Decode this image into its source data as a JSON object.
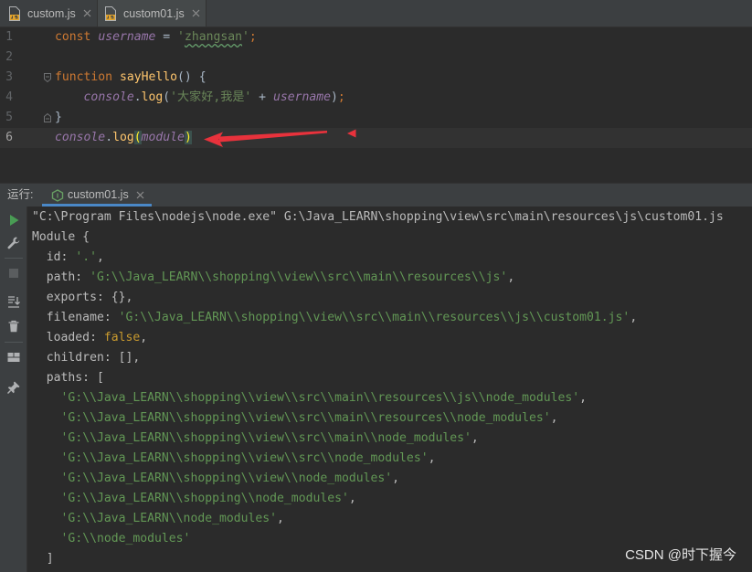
{
  "colors": {
    "editor_bg": "#2B2B2B",
    "panel_bg": "#3C3F41",
    "accent": "#4A88C7",
    "current_line": "#323232",
    "annotation": "#E8323C"
  },
  "editor_tabs": [
    {
      "label": "custom.js",
      "icon": "js-file-icon",
      "close_icon": "close-icon"
    },
    {
      "label": "custom01.js",
      "icon": "js-file-icon",
      "close_icon": "close-icon",
      "active": true
    }
  ],
  "editor": {
    "lines": [
      {
        "number": "1",
        "tokens": [
          {
            "text": "const",
            "color": "#CC7832"
          },
          {
            "text": " ",
            "color": "#A9B7C6"
          },
          {
            "text": "username",
            "color": "#9876AA",
            "italic": true
          },
          {
            "text": " = ",
            "color": "#A9B7C6"
          },
          {
            "text": "'",
            "color": "#6A8759"
          },
          {
            "text": "zhangsan",
            "color": "#6A8759",
            "typo": true
          },
          {
            "text": "'",
            "color": "#6A8759"
          },
          {
            "text": ";",
            "color": "#CC7832"
          }
        ]
      },
      {
        "number": "2",
        "tokens": []
      },
      {
        "number": "3",
        "fold_icon": "fold-open-icon",
        "tokens": [
          {
            "text": "function",
            "color": "#CC7832"
          },
          {
            "text": " ",
            "color": "#A9B7C6"
          },
          {
            "text": "sayHello",
            "color": "#FFC66D"
          },
          {
            "text": "() {",
            "color": "#A9B7C6"
          }
        ]
      },
      {
        "number": "4",
        "tokens": [
          {
            "text": "    ",
            "color": "#A9B7C6"
          },
          {
            "text": "console",
            "color": "#9876AA",
            "italic": true
          },
          {
            "text": ".",
            "color": "#A9B7C6"
          },
          {
            "text": "log",
            "color": "#FFC66D"
          },
          {
            "text": "(",
            "color": "#A9B7C6"
          },
          {
            "text": "'大家好,我是'",
            "color": "#6A8759"
          },
          {
            "text": " + ",
            "color": "#A9B7C6"
          },
          {
            "text": "username",
            "color": "#9876AA",
            "italic": true
          },
          {
            "text": ")",
            "color": "#A9B7C6"
          },
          {
            "text": ";",
            "color": "#CC7832"
          }
        ]
      },
      {
        "number": "5",
        "fold_icon": "fold-end-icon",
        "tokens": [
          {
            "text": "}",
            "color": "#A9B7C6"
          }
        ]
      },
      {
        "number": "6",
        "current": true,
        "tokens": [
          {
            "text": "console",
            "color": "#9876AA",
            "italic": true
          },
          {
            "text": ".",
            "color": "#A9B7C6"
          },
          {
            "text": "log",
            "color": "#FFC66D"
          },
          {
            "text": "(",
            "color": "#FFEF28",
            "bg": "#3B514D"
          },
          {
            "text": "module",
            "color": "#9876AA",
            "italic": true
          },
          {
            "text": ")",
            "color": "#FFEF28",
            "bg": "#3B514D"
          }
        ]
      }
    ]
  },
  "run_panel": {
    "label": "运行:",
    "tab": {
      "label": "custom01.js",
      "icon": "nodejs-icon",
      "close_icon": "close-icon"
    },
    "toolbar": [
      "rerun-icon",
      "wrench-icon",
      "stop-icon",
      "scroll-to-end-icon",
      "trash-icon",
      "layout-icon",
      "pin-icon"
    ],
    "console_lines": [
      {
        "tokens": [
          {
            "text": "\"C:\\Program Files\\nodejs\\node.exe\" G:\\Java_LEARN\\shopping\\view\\src\\main\\resources\\js\\custom01.js",
            "color": "#BBBBBB"
          }
        ]
      },
      {
        "tokens": [
          {
            "text": "Module {",
            "color": "#BBBBBB"
          }
        ]
      },
      {
        "tokens": [
          {
            "text": "  id: ",
            "color": "#BBBBBB"
          },
          {
            "text": "'.'",
            "color": "#629755"
          },
          {
            "text": ",",
            "color": "#BBBBBB"
          }
        ]
      },
      {
        "tokens": [
          {
            "text": "  path: ",
            "color": "#BBBBBB"
          },
          {
            "text": "'G:\\\\Java_LEARN\\\\shopping\\\\view\\\\src\\\\main\\\\resources\\\\js'",
            "color": "#629755"
          },
          {
            "text": ",",
            "color": "#BBBBBB"
          }
        ]
      },
      {
        "tokens": [
          {
            "text": "  exports: {},",
            "color": "#BBBBBB"
          }
        ]
      },
      {
        "tokens": [
          {
            "text": "  filename: ",
            "color": "#BBBBBB"
          },
          {
            "text": "'G:\\\\Java_LEARN\\\\shopping\\\\view\\\\src\\\\main\\\\resources\\\\js\\\\custom01.js'",
            "color": "#629755"
          },
          {
            "text": ",",
            "color": "#BBBBBB"
          }
        ]
      },
      {
        "tokens": [
          {
            "text": "  loaded: ",
            "color": "#BBBBBB"
          },
          {
            "text": "false",
            "color": "#C99A2E"
          },
          {
            "text": ",",
            "color": "#BBBBBB"
          }
        ]
      },
      {
        "tokens": [
          {
            "text": "  children: [],",
            "color": "#BBBBBB"
          }
        ]
      },
      {
        "tokens": [
          {
            "text": "  paths: [",
            "color": "#BBBBBB"
          }
        ]
      },
      {
        "tokens": [
          {
            "text": "    ",
            "color": "#BBBBBB"
          },
          {
            "text": "'G:\\\\Java_LEARN\\\\shopping\\\\view\\\\src\\\\main\\\\resources\\\\js\\\\node_modules'",
            "color": "#629755"
          },
          {
            "text": ",",
            "color": "#BBBBBB"
          }
        ]
      },
      {
        "tokens": [
          {
            "text": "    ",
            "color": "#BBBBBB"
          },
          {
            "text": "'G:\\\\Java_LEARN\\\\shopping\\\\view\\\\src\\\\main\\\\resources\\\\node_modules'",
            "color": "#629755"
          },
          {
            "text": ",",
            "color": "#BBBBBB"
          }
        ]
      },
      {
        "tokens": [
          {
            "text": "    ",
            "color": "#BBBBBB"
          },
          {
            "text": "'G:\\\\Java_LEARN\\\\shopping\\\\view\\\\src\\\\main\\\\node_modules'",
            "color": "#629755"
          },
          {
            "text": ",",
            "color": "#BBBBBB"
          }
        ]
      },
      {
        "tokens": [
          {
            "text": "    ",
            "color": "#BBBBBB"
          },
          {
            "text": "'G:\\\\Java_LEARN\\\\shopping\\\\view\\\\src\\\\node_modules'",
            "color": "#629755"
          },
          {
            "text": ",",
            "color": "#BBBBBB"
          }
        ]
      },
      {
        "tokens": [
          {
            "text": "    ",
            "color": "#BBBBBB"
          },
          {
            "text": "'G:\\\\Java_LEARN\\\\shopping\\\\view\\\\node_modules'",
            "color": "#629755"
          },
          {
            "text": ",",
            "color": "#BBBBBB"
          }
        ]
      },
      {
        "tokens": [
          {
            "text": "    ",
            "color": "#BBBBBB"
          },
          {
            "text": "'G:\\\\Java_LEARN\\\\shopping\\\\node_modules'",
            "color": "#629755"
          },
          {
            "text": ",",
            "color": "#BBBBBB"
          }
        ]
      },
      {
        "tokens": [
          {
            "text": "    ",
            "color": "#BBBBBB"
          },
          {
            "text": "'G:\\\\Java_LEARN\\\\node_modules'",
            "color": "#629755"
          },
          {
            "text": ",",
            "color": "#BBBBBB"
          }
        ]
      },
      {
        "tokens": [
          {
            "text": "    ",
            "color": "#BBBBBB"
          },
          {
            "text": "'G:\\\\node_modules'",
            "color": "#629755"
          }
        ]
      },
      {
        "tokens": [
          {
            "text": "  ]",
            "color": "#BBBBBB"
          }
        ]
      }
    ]
  },
  "watermark": "CSDN @时下握今"
}
